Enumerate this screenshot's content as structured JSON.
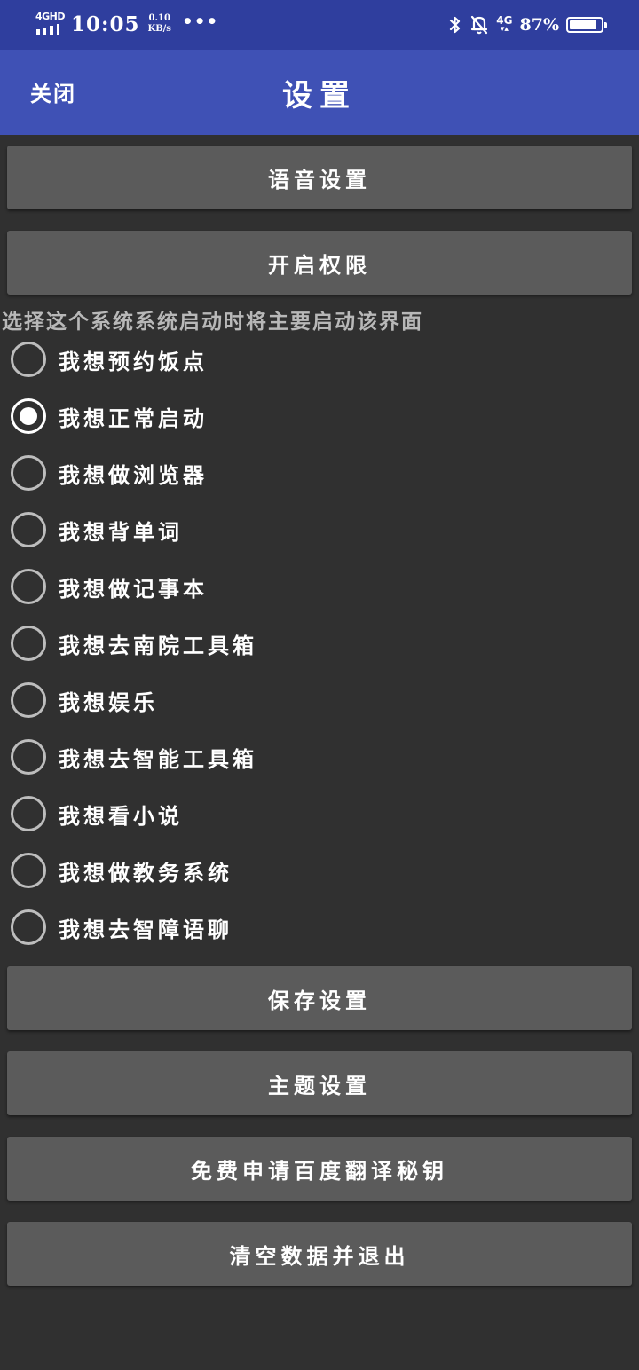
{
  "status_bar": {
    "network_type": "4GHD",
    "time": "10:05",
    "speed_value": "0.10",
    "speed_unit": "KB/s",
    "more": "•••",
    "icons": [
      "bluetooth-icon",
      "bell-muted-icon",
      "4g-data-icon"
    ],
    "mobile_data": "4G",
    "battery_percent": "87%",
    "battery_level": 0.87
  },
  "app_bar": {
    "close_label": "关闭",
    "title": "设置"
  },
  "buttons": {
    "voice_settings": "语音设置",
    "enable_permissions": "开启权限",
    "save_settings": "保存设置",
    "theme_settings": "主题设置",
    "baidu_key": "免费申请百度翻译秘钥",
    "clear_exit": "清空数据并退出"
  },
  "startup": {
    "label": "选择这个系统系统启动时将主要启动该界面",
    "selected_index": 1,
    "options": [
      {
        "label": "我想预约饭点"
      },
      {
        "label": "我想正常启动"
      },
      {
        "label": "我想做浏览器"
      },
      {
        "label": "我想背单词"
      },
      {
        "label": "我想做记事本"
      },
      {
        "label": "我想去南院工具箱"
      },
      {
        "label": "我想娱乐"
      },
      {
        "label": "我想去智能工具箱"
      },
      {
        "label": "我想看小说"
      },
      {
        "label": "我想做教务系统"
      },
      {
        "label": "我想去智障语聊"
      }
    ]
  },
  "colors": {
    "status_bar": "#2f3e9e",
    "app_bar": "#3f51b5",
    "background": "#303030",
    "button": "#5b5b5b"
  }
}
